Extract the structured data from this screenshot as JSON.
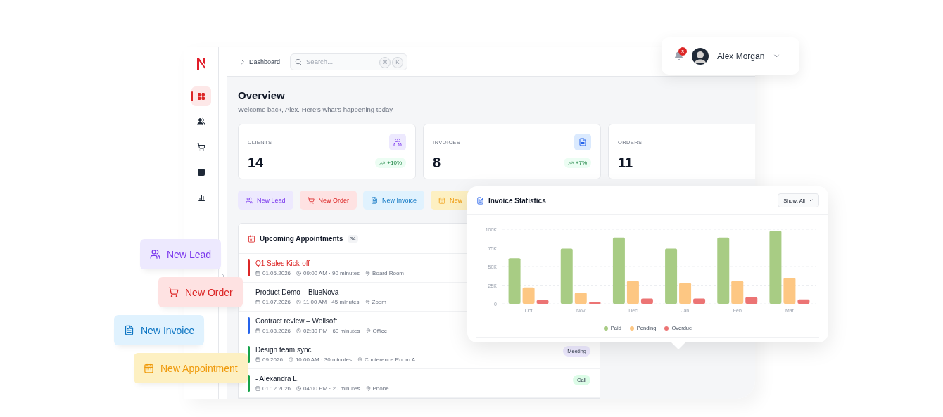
{
  "header": {
    "breadcrumb": "Dashboard",
    "search": {
      "placeholder": "Search...",
      "shortcut": [
        "⌘",
        "K"
      ]
    }
  },
  "sidebar": {
    "items": [
      {
        "kind": "dashboard",
        "selected": true
      },
      {
        "kind": "clients",
        "selected": false
      },
      {
        "kind": "orders",
        "selected": false
      },
      {
        "kind": "tasks",
        "selected": false
      },
      {
        "kind": "reports",
        "selected": false
      }
    ]
  },
  "profile": {
    "notifications": "3",
    "name": "Alex Morgan"
  },
  "overview": {
    "title": "Overview",
    "subtitle": "Welcome back, Alex. Here's what's happening today."
  },
  "stats": [
    {
      "kind": "clients",
      "label": "CLIENTS",
      "value": "14",
      "change": "+10%"
    },
    {
      "kind": "invoices",
      "label": "INVOICES",
      "value": "8",
      "change": "+7%"
    },
    {
      "kind": "orders",
      "label": "ORDERS",
      "value": "11"
    }
  ],
  "quick_actions": [
    {
      "kind": "lead",
      "label": "New Lead"
    },
    {
      "kind": "order",
      "label": "New Order"
    },
    {
      "kind": "invoice",
      "label": "New Invoice"
    },
    {
      "kind": "appointment",
      "label": "New"
    }
  ],
  "appointments": {
    "title": "Upcoming Appointments",
    "count": "34",
    "items": [
      {
        "title": "Q1 Sales Kick-off",
        "highlighted": true,
        "color": "#dc2626",
        "date": "01.05.2026",
        "time": "09:00 AM · 90 minutes",
        "location": "Board Room"
      },
      {
        "title": "Product Demo – BlueNova",
        "highlighted": false,
        "date": "01.07.2026",
        "time": "11:00 AM · 45 minutes",
        "location": "Zoom"
      },
      {
        "title": "Contract review – Wellsoft",
        "highlighted": false,
        "color": "#2563eb",
        "date": "01.08.2026",
        "time": "02:30 PM · 60 minutes",
        "location": "Office"
      },
      {
        "title": "Design team sync",
        "highlighted": false,
        "color": "#16a34a",
        "date": "09.2026",
        "time": "10:00 AM · 30 minutes",
        "location": "Conference Room A",
        "tag": {
          "label": "Meeting",
          "color": "#ede9fe"
        }
      },
      {
        "title": "- Alexandra L.",
        "highlighted": false,
        "color": "#16a34a",
        "date": "01.12.2026",
        "time": "04:00 PM · 20 minutes",
        "location": "Phone",
        "tag": {
          "label": "Call",
          "color": "#dcfce7"
        }
      }
    ]
  },
  "invoice_statistics": {
    "title": "Invoice Statistics",
    "filter": "Show: All",
    "chart_data": {
      "type": "bar",
      "grid": true,
      "categories": [
        "Oct",
        "Nov",
        "Dec",
        "Jan",
        "Feb",
        "Mar"
      ],
      "ylim": [
        0,
        100000
      ],
      "yticks": [
        {
          "value": 0,
          "label": "0"
        },
        {
          "value": 25000,
          "label": "25K"
        },
        {
          "value": 50000,
          "label": "50K"
        },
        {
          "value": 75000,
          "label": "75K"
        },
        {
          "value": 100000,
          "label": "100K"
        }
      ],
      "series": [
        {
          "name": "Paid",
          "color": "#a8cc84",
          "values": [
            61000,
            74000,
            89000,
            74000,
            89000,
            98000
          ]
        },
        {
          "name": "Pending",
          "color": "#fdc783",
          "values": [
            22000,
            15000,
            31000,
            28000,
            31000,
            35000
          ]
        },
        {
          "name": "Overdue",
          "color": "#ec7474",
          "values": [
            5000,
            2000,
            7000,
            7000,
            9000,
            6000
          ]
        }
      ]
    }
  },
  "floating_actions": [
    {
      "kind": "lead",
      "label": "New Lead"
    },
    {
      "kind": "order",
      "label": "New Order"
    },
    {
      "kind": "invoice",
      "label": "New Invoice"
    },
    {
      "kind": "appointment",
      "label": "New Appointment"
    }
  ]
}
